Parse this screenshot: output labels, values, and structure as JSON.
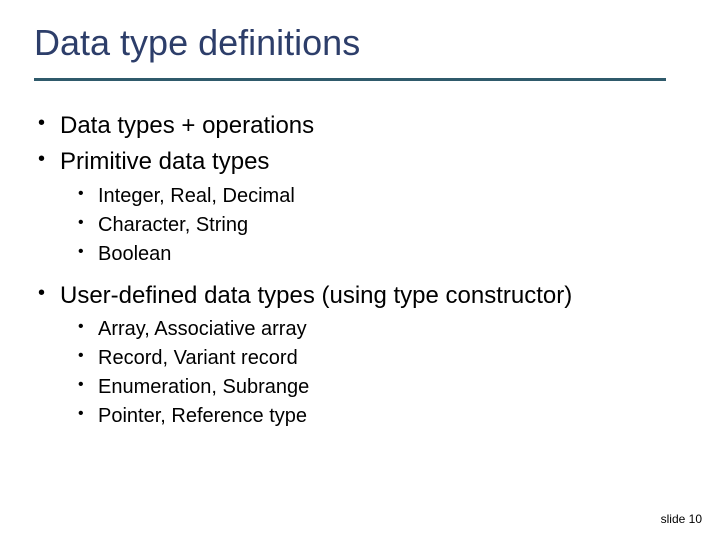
{
  "title": "Data type definitions",
  "bullets": {
    "b1": "Data types + operations",
    "b2": "Primitive data types",
    "b2_items": {
      "i1": "Integer, Real, Decimal",
      "i2": "Character, String",
      "i3": "Boolean"
    },
    "b3": "User-defined data types (using type constructor)",
    "b3_items": {
      "i1": "Array, Associative array",
      "i2": "Record, Variant record",
      "i3": "Enumeration, Subrange",
      "i4": "Pointer, Reference type"
    }
  },
  "footer": "slide 10"
}
